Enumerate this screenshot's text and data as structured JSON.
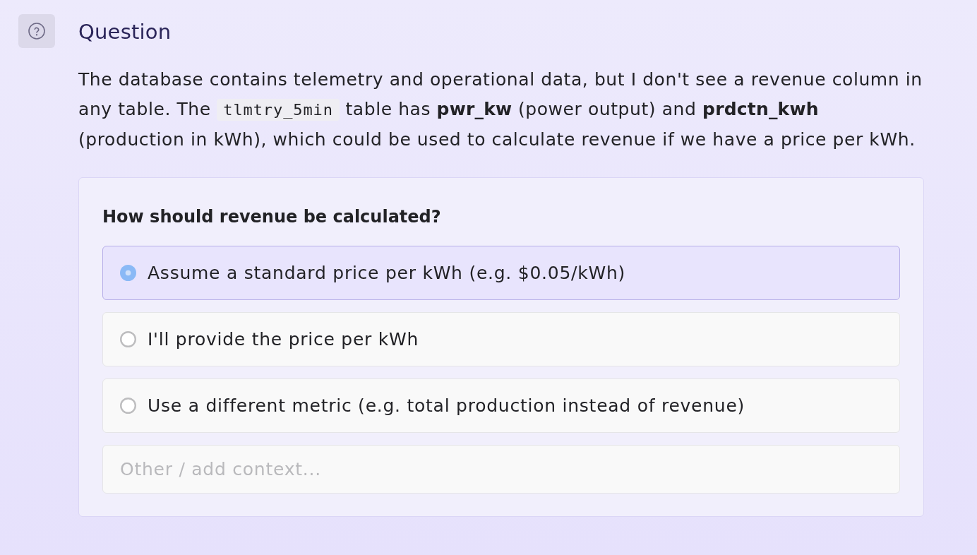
{
  "header": {
    "title": "Question"
  },
  "description": {
    "parts": [
      {
        "kind": "text",
        "text": "The database contains telemetry and operational data, but I don't see a revenue column in any table. The "
      },
      {
        "kind": "code",
        "text": "tlmtry_5min"
      },
      {
        "kind": "text",
        "text": " table has **pwr_kw** (power output) and **prdctn_kwh** (production in kWh), which could be used to calculate revenue if we have a price per kWh."
      }
    ]
  },
  "question_card": {
    "prompt": "How should revenue be calculated?",
    "options": [
      {
        "label": "Assume a standard price per kWh (e.g. $0.05/kWh)",
        "selected": true
      },
      {
        "label": "I'll provide the price per kWh",
        "selected": false
      },
      {
        "label": "Use a different metric (e.g. total production instead of revenue)",
        "selected": false
      }
    ],
    "other_field": {
      "placeholder": "Other / add context..."
    }
  }
}
